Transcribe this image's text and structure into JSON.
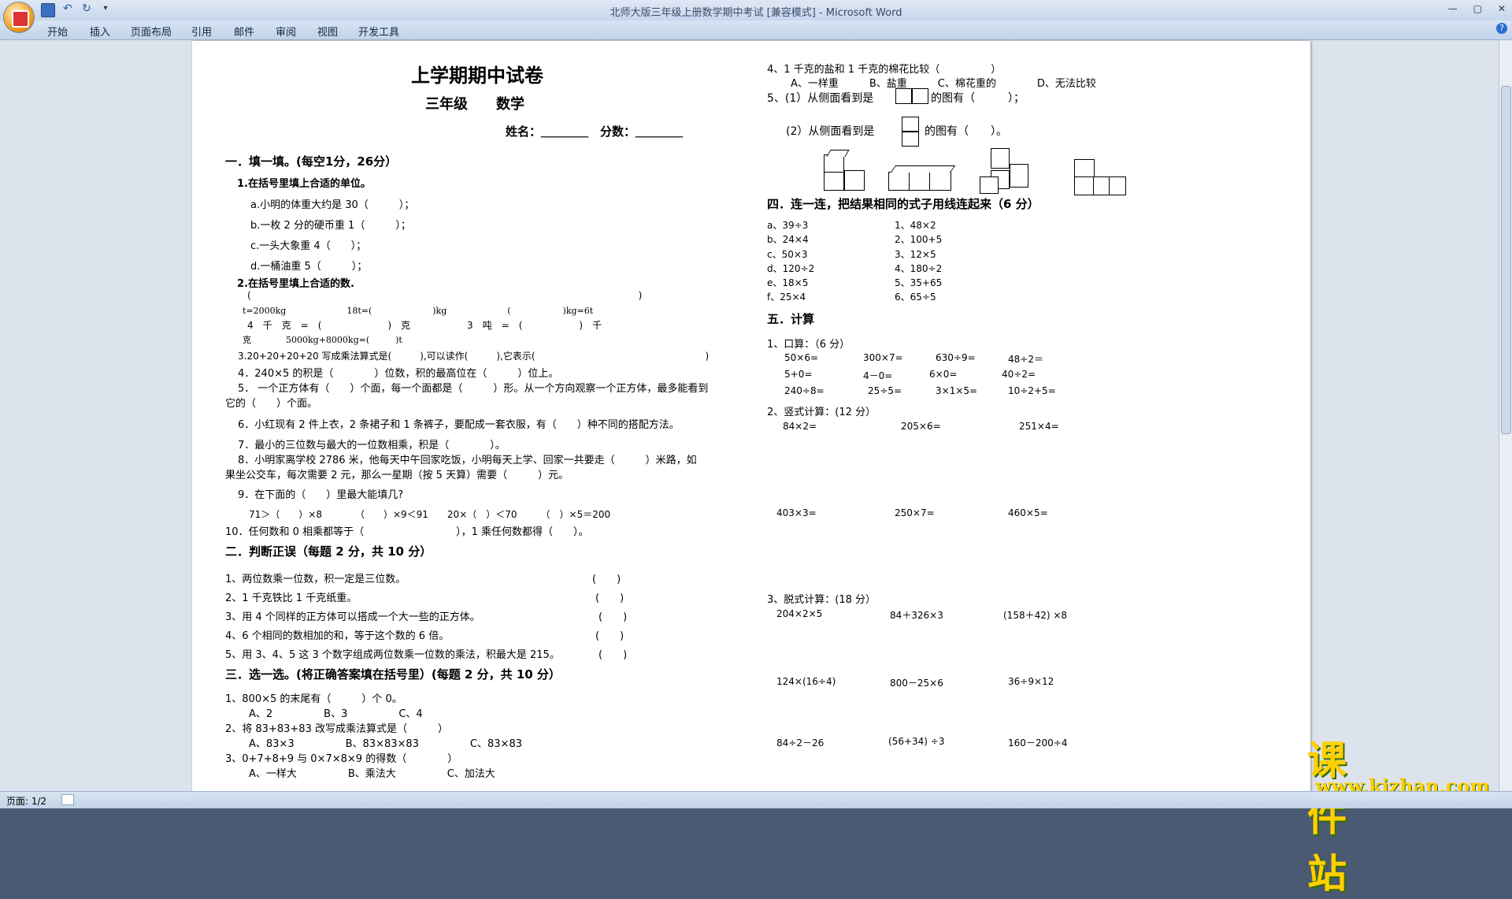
{
  "window": {
    "title": "北师大版三年级上册数学期中考试 [兼容模式] - Microsoft Word",
    "controls": [
      "—",
      "▢",
      "✕"
    ]
  },
  "menu": [
    "开始",
    "插入",
    "页面布局",
    "引用",
    "邮件",
    "审阅",
    "视图",
    "开发工具"
  ],
  "status": {
    "page": "页面: 1/2"
  },
  "watermark": {
    "text": "课件站",
    "url": "www.kjzhan.com"
  },
  "doc": {
    "title": "上学期期中试卷",
    "subtitle": "三年级　　数学",
    "name_score": "姓名：＿＿＿＿　分数：＿＿＿＿",
    "s1": {
      "heading": "一．填一填。(每空1分，26分）",
      "q1_title": "1.在括号里填上合适的单位。",
      "q1_a": "a.小明的体重大约是 30（　　　）；",
      "q1_b": "b.一枚 2 分的硬币重 1（　　　）；",
      "q1_c": "c.一头大象重 4（　　）；",
      "q1_d": "d.一桶油重 5（　　　）；",
      "q2_title": "2.在括号里填上合适的数.",
      "q2_l1": "(　　　　　　　　　　　　　　　　　　　　　　　　　　　　　　　　　　　　　　　　　)",
      "q2_l2": "t=2000kg　　　　　　　18t=(　　　　　　　)kg　　　　　　　(　　　　　　)kg=6t",
      "q2_l3": "4　千　克　=　(　　　　　　　)　克　　　　　　3　吨　=　(　　　　　　)　千",
      "q2_l4": "克　　　　5000kg+8000kg=(　　　)t",
      "q3": "3.20+20+20+20 写成乘法算式是(　　　),可以读作(　　　),它表示(　　　　　　　　　　　　　　　　　　)",
      "q4": "4．240×5 的积是（　　　　）位数，积的最高位在（　　　）位上。",
      "q5a": "5．  一个正方体有（　　）个面，每一个面都是（　　　）形。从一个方向观察一个正方体，最多能看到",
      "q5b": "它的（　　）个面。",
      "q6": "6．小红现有 2 件上衣，2 条裙子和 1 条裤子，要配成一套衣服，有（　　）种不同的搭配方法。",
      "q7": "7．最小的三位数与最大的一位数相乘，积是（　　　　）。",
      "q8a": "8．小明家离学校 2786 米，他每天中午回家吃饭，小明每天上学、回家一共要走（　　　）米路，如",
      "q8b": "果坐公交车，每次需要 2 元，那么一星期（按 5 天算）需要（　　　）元。",
      "q9": "9．在下面的（　　）里最大能填几?",
      "q9_items": "71＞（　　）×8　　　　（　　）×9＜91　　20×（　）＜70　　　（　）×5＝200",
      "q10": "10．任何数和 0 相乘都等于（　　　　　　　　　），1 乘任何数都得（　　）。"
    },
    "s2": {
      "heading": "二．判断正误（每题 2 分，共 10 分）",
      "items": [
        "1、两位数乘一位数，积一定是三位数。",
        "2、1 千克铁比 1 千克纸重。",
        "3、用 4 个同样的正方体可以搭成一个大一些的正方体。",
        "4、6 个相同的数相加的和，等于这个数的 6 倍。",
        "5、用 3、4、5 这 3 个数字组成两位数乘一位数的乘法，积最大是 215。"
      ],
      "paren": "(　　)"
    },
    "s3": {
      "heading": "三．选一选。(将正确答案填在括号里）(每题 2 分，共 10 分）",
      "q1": "1、800×5 的末尾有（　　　）个 0。",
      "q1_opts": "A、2　　　　　B、3　　　　　C、4",
      "q2": "2、将 83+83+83 改写成乘法算式是（　　　）",
      "q2_opts": "A、83×3　　　　　B、83×83×83　　　　　C、83×83",
      "q3": "3、0+7+8+9 与 0×7×8×9 的得数（　　　　）",
      "q3_opts": "A、一样大　　　　　B、乘法大　　　　　C、加法大",
      "q4": "4、1 千克的盐和 1 千克的棉花比较（　　　　　）",
      "q4_opts": "A、一样重　　　B、盐重　　　C、棉花重的　　　　D、无法比较",
      "q5_1a": "5、(1）从侧面看到是",
      "q5_1b": "的图有（　　　）；",
      "q5_2a": "(2）从侧面看到是",
      "q5_2b": "的图有（　　）。"
    },
    "s4": {
      "heading": "四．连一连，把结果相同的式子用线连起来（6 分）",
      "left": [
        "a、39÷3",
        "b、24×4",
        "c、50×3",
        "d、120÷2",
        "e、18×5",
        "f、25×4"
      ],
      "right": [
        "1、48×2",
        "2、100+5",
        "3、12×5",
        "4、180÷2",
        "5、35+65",
        "6、65÷5"
      ]
    },
    "s5": {
      "heading": "五．计算",
      "oral_title": "1、口算：（6 分）",
      "oral": [
        [
          "50×6=",
          "300×7=",
          "630÷9=",
          "48÷2＝"
        ],
        [
          "5+0=",
          "4－0=",
          "6×0=",
          "40÷2="
        ],
        [
          "240÷8=",
          "25÷5=",
          "3×1×5=",
          "10÷2+5="
        ]
      ],
      "vertical_title": "2、竖式计算：(12 分）",
      "vertical_row1": [
        "84×2=",
        "205×6=",
        "251×4="
      ],
      "vertical_row2": [
        "403×3=",
        "250×7=",
        "460×5="
      ],
      "mixed_title": "3、脱式计算：(18 分）",
      "mixed_row1": [
        "204×2×5",
        "84＋326×3",
        "(158＋42) ×8"
      ],
      "mixed_row2": [
        "124×(16÷4)",
        "800－25×6",
        "36÷9×12"
      ],
      "mixed_row3": [
        "84÷2－26",
        "(56+34) ÷3",
        "160－200÷4"
      ]
    }
  }
}
